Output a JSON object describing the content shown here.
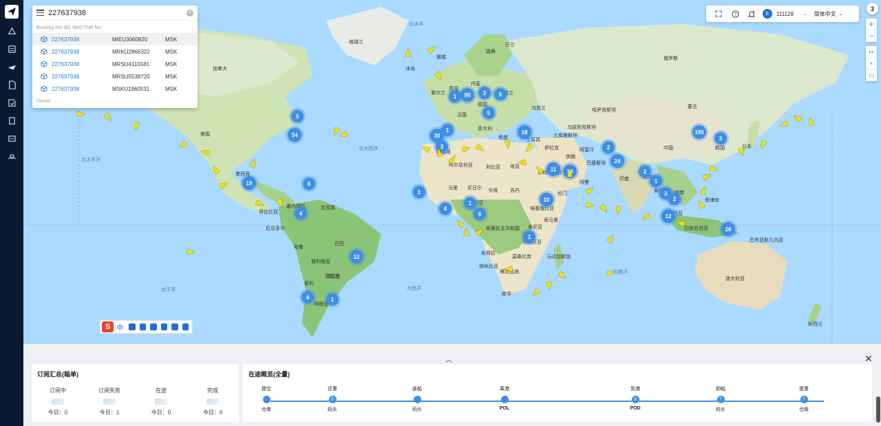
{
  "search": {
    "query": "227637938",
    "section_booking": "Booking No/ B/L No/CTNR No",
    "section_vessel": "Vessel",
    "results": [
      {
        "booking": "227637938",
        "container": "MIEU3060820",
        "carrier": "MSK"
      },
      {
        "booking": "227637938",
        "container": "MRKU2866322",
        "carrier": "MSK"
      },
      {
        "booking": "227637938",
        "container": "MRSU4115581",
        "carrier": "MSK"
      },
      {
        "booking": "227637938",
        "container": "MRSU5538720",
        "carrier": "MSK"
      },
      {
        "booking": "227637938",
        "container": "MSKU1960531",
        "carrier": "MSK"
      }
    ]
  },
  "toolbar": {
    "avatar_letter": "E",
    "user_id": "111128",
    "language": "简体中文",
    "notification_badge": "3"
  },
  "map": {
    "clusters": [
      "5",
      "34",
      "19",
      "6",
      "4",
      "12",
      "4",
      "1",
      "30",
      "1",
      "3",
      "99",
      "1",
      "3",
      "5",
      "5",
      "18",
      "1",
      "4",
      "8",
      "1",
      "11",
      "14",
      "10",
      "2",
      "24",
      "2",
      "1",
      "3",
      "2",
      "12",
      "195",
      "3",
      "26",
      "1"
    ],
    "labels": {
      "arctic": "北冰洋",
      "north_pacific_w": "北太平洋",
      "north_atlantic": "北大西洋",
      "south_pacific": "太平洋",
      "south_atlantic": "大西洋",
      "indian": "印度洋",
      "greenland": "格陵兰",
      "iceland": "冰岛",
      "canada": "加拿大",
      "mexico": "墨西哥",
      "cuba": "古巴",
      "venezuela": "委内瑞拉",
      "colombia": "哥伦比亚",
      "ecuador": "厄瓜多尔",
      "peru": "秘鲁",
      "brazil": "巴西",
      "bolivia": "玻利维亚",
      "paraguay": "巴拉圭",
      "chile": "智利",
      "argentina": "阿根廷",
      "uruguay": "乌拉圭",
      "guyana": "圭亚那",
      "uk": "英国",
      "ireland": "爱尔兰",
      "france": "法国",
      "spain": "西班牙",
      "portugal": "葡萄牙",
      "germany": "德国",
      "poland": "波兰",
      "ukraine": "乌克兰",
      "sweden": "瑞典",
      "finland": "芬兰",
      "norway": "挪威",
      "denmark": "丹麦",
      "italy": "意大利",
      "greece": "希腊",
      "turkey": "土耳其",
      "russia": "俄罗斯",
      "kazakhstan": "哈萨克斯坦",
      "mongolia": "蒙古",
      "china": "中国",
      "japan": "日本",
      "korea": "韩国",
      "india": "印度",
      "pakistan": "巴基斯坦",
      "afghanistan": "阿富汗",
      "iran": "伊朗",
      "iraq": "伊拉克",
      "saudi": "沙特阿拉伯",
      "oman": "阿曼",
      "yemen": "也门",
      "egypt": "埃及",
      "libya": "利比亚",
      "algeria": "阿尔及利亚",
      "morocco": "摩洛哥",
      "mali": "马里",
      "niger": "尼日尔",
      "chad": "乍得",
      "sudan": "苏丹",
      "ethiopia": "埃塞俄比亚",
      "somalia": "索马里",
      "kenya": "肯尼亚",
      "tanzania": "坦桑尼亚",
      "drc": "刚果民主共和国",
      "angola": "安哥拉",
      "namibia": "纳米比亚",
      "botswana": "博茨瓦纳",
      "south_africa": "南非",
      "madagascar": "马达加斯加",
      "mozambique": "莫桑比克",
      "nigeria": "尼日利亚",
      "thailand": "泰国",
      "vietnam": "越南",
      "myanmar": "缅甸",
      "philippines": "菲律宾",
      "malaysia": "马来西亚",
      "indonesia": "印度尼西亚",
      "png": "巴布亚新几内亚",
      "australia": "澳大利亚",
      "new_zealand": "新西兰",
      "usa": "美国",
      "uzbekistan": "乌兹别克斯坦",
      "turkmenistan": "土库曼斯坦"
    }
  },
  "ime": {
    "logo": "S",
    "mode": "中"
  },
  "bottom": {
    "summary": {
      "title": "订阅汇总(箱单)",
      "cols": [
        {
          "label": "订阅中",
          "today": "今日：0"
        },
        {
          "label": "订阅失败",
          "today": "今日：1"
        },
        {
          "label": "在途",
          "today": "今日：0"
        },
        {
          "label": "完成",
          "today": "今日：0"
        }
      ]
    },
    "transit": {
      "title": "在途概览(全量)",
      "stages": [
        {
          "top": "提空",
          "count": "",
          "bottom": "仓库"
        },
        {
          "top": "还重",
          "count": "0",
          "bottom": "码头"
        },
        {
          "top": "装船",
          "count": "",
          "bottom": "码头"
        },
        {
          "top": "离港",
          "count": "",
          "bottom": "POL"
        },
        {
          "top": "到港",
          "count": "3",
          "bottom": "POD"
        },
        {
          "top": "卸船",
          "count": "7",
          "bottom": "码头"
        },
        {
          "top": "提重",
          "count": "7",
          "bottom": "仓库"
        }
      ]
    }
  }
}
